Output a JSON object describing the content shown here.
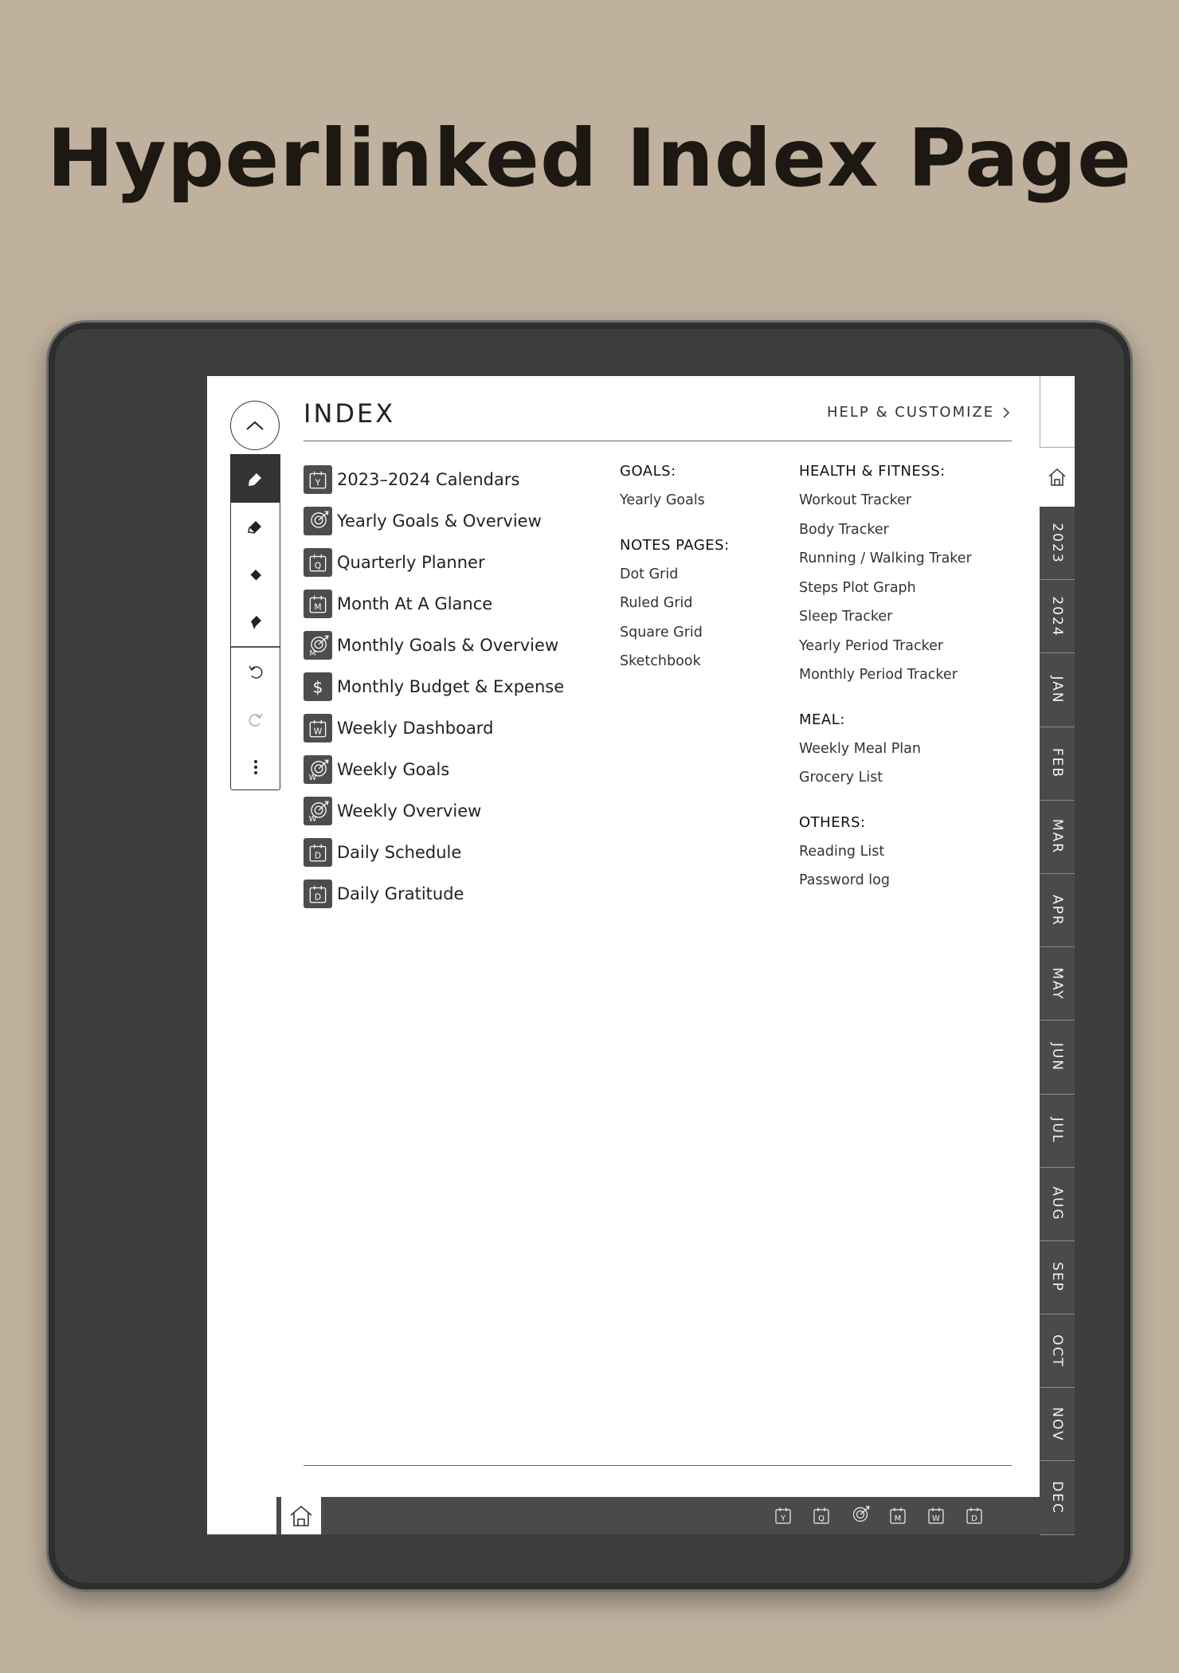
{
  "hero": {
    "title": "Hyperlinked Index Page"
  },
  "header": {
    "title": "INDEX",
    "help_label": "HELP & CUSTOMIZE"
  },
  "index_items": [
    {
      "icon": "Y",
      "label": "2023–2024 Calendars"
    },
    {
      "icon": "goal",
      "label": "Yearly Goals & Overview"
    },
    {
      "icon": "Q",
      "label": "Quarterly Planner"
    },
    {
      "icon": "M",
      "label": "Month At A Glance"
    },
    {
      "icon": "goal-m",
      "label": "Monthly Goals & Overview"
    },
    {
      "icon": "$",
      "label": "Monthly Budget & Expense"
    },
    {
      "icon": "W",
      "label": "Weekly Dashboard"
    },
    {
      "icon": "goal-w",
      "label": "Weekly Goals"
    },
    {
      "icon": "goal-w",
      "label": "Weekly Overview"
    },
    {
      "icon": "D",
      "label": "Daily Schedule"
    },
    {
      "icon": "D",
      "label": "Daily Gratitude"
    }
  ],
  "goals": {
    "heading": "GOALS:",
    "items": [
      "Yearly Goals"
    ]
  },
  "notes": {
    "heading": "NOTES PAGES:",
    "items": [
      "Dot Grid",
      "Ruled Grid",
      "Square Grid",
      "Sketchbook"
    ]
  },
  "health": {
    "heading": "HEALTH & FITNESS:",
    "items": [
      "Workout Tracker",
      "Body Tracker",
      "Running / Walking Traker",
      "Steps Plot Graph",
      "Sleep Tracker",
      "Yearly Period Tracker",
      "Monthly Period Tracker"
    ]
  },
  "meal": {
    "heading": "MEAL:",
    "items": [
      "Weekly Meal Plan",
      "Grocery List"
    ]
  },
  "others": {
    "heading": "OTHERS:",
    "items": [
      "Reading List",
      "Password log"
    ]
  },
  "tabs": [
    "2023",
    "2024",
    "JAN",
    "FEB",
    "MAR",
    "APR",
    "MAY",
    "JUN",
    "JUL",
    "AUG",
    "SEP",
    "OCT",
    "NOV",
    "DEC"
  ],
  "bottom_icons": [
    "Y",
    "Q",
    "goal",
    "M",
    "W",
    "D"
  ],
  "toolbar": [
    "pen-icon",
    "highlighter-icon",
    "eraser-icon",
    "lasso-icon",
    "undo-icon",
    "redo-icon",
    "more-icon"
  ],
  "colors": {
    "background": "#bfb19e",
    "device": "#3d3d3d",
    "tab": "#4a4a4a",
    "icon_tile": "#4d4d4d"
  }
}
